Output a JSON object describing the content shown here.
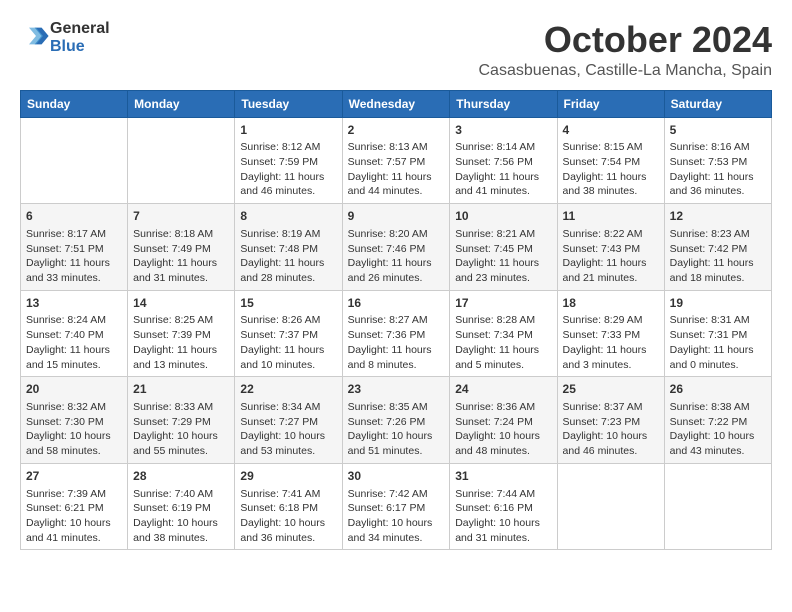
{
  "header": {
    "logo_line1": "General",
    "logo_line2": "Blue",
    "month": "October 2024",
    "location": "Casasbuenas, Castille-La Mancha, Spain"
  },
  "days_of_week": [
    "Sunday",
    "Monday",
    "Tuesday",
    "Wednesday",
    "Thursday",
    "Friday",
    "Saturday"
  ],
  "weeks": [
    [
      {
        "day": "",
        "content": ""
      },
      {
        "day": "",
        "content": ""
      },
      {
        "day": "1",
        "content": "Sunrise: 8:12 AM\nSunset: 7:59 PM\nDaylight: 11 hours and 46 minutes."
      },
      {
        "day": "2",
        "content": "Sunrise: 8:13 AM\nSunset: 7:57 PM\nDaylight: 11 hours and 44 minutes."
      },
      {
        "day": "3",
        "content": "Sunrise: 8:14 AM\nSunset: 7:56 PM\nDaylight: 11 hours and 41 minutes."
      },
      {
        "day": "4",
        "content": "Sunrise: 8:15 AM\nSunset: 7:54 PM\nDaylight: 11 hours and 38 minutes."
      },
      {
        "day": "5",
        "content": "Sunrise: 8:16 AM\nSunset: 7:53 PM\nDaylight: 11 hours and 36 minutes."
      }
    ],
    [
      {
        "day": "6",
        "content": "Sunrise: 8:17 AM\nSunset: 7:51 PM\nDaylight: 11 hours and 33 minutes."
      },
      {
        "day": "7",
        "content": "Sunrise: 8:18 AM\nSunset: 7:49 PM\nDaylight: 11 hours and 31 minutes."
      },
      {
        "day": "8",
        "content": "Sunrise: 8:19 AM\nSunset: 7:48 PM\nDaylight: 11 hours and 28 minutes."
      },
      {
        "day": "9",
        "content": "Sunrise: 8:20 AM\nSunset: 7:46 PM\nDaylight: 11 hours and 26 minutes."
      },
      {
        "day": "10",
        "content": "Sunrise: 8:21 AM\nSunset: 7:45 PM\nDaylight: 11 hours and 23 minutes."
      },
      {
        "day": "11",
        "content": "Sunrise: 8:22 AM\nSunset: 7:43 PM\nDaylight: 11 hours and 21 minutes."
      },
      {
        "day": "12",
        "content": "Sunrise: 8:23 AM\nSunset: 7:42 PM\nDaylight: 11 hours and 18 minutes."
      }
    ],
    [
      {
        "day": "13",
        "content": "Sunrise: 8:24 AM\nSunset: 7:40 PM\nDaylight: 11 hours and 15 minutes."
      },
      {
        "day": "14",
        "content": "Sunrise: 8:25 AM\nSunset: 7:39 PM\nDaylight: 11 hours and 13 minutes."
      },
      {
        "day": "15",
        "content": "Sunrise: 8:26 AM\nSunset: 7:37 PM\nDaylight: 11 hours and 10 minutes."
      },
      {
        "day": "16",
        "content": "Sunrise: 8:27 AM\nSunset: 7:36 PM\nDaylight: 11 hours and 8 minutes."
      },
      {
        "day": "17",
        "content": "Sunrise: 8:28 AM\nSunset: 7:34 PM\nDaylight: 11 hours and 5 minutes."
      },
      {
        "day": "18",
        "content": "Sunrise: 8:29 AM\nSunset: 7:33 PM\nDaylight: 11 hours and 3 minutes."
      },
      {
        "day": "19",
        "content": "Sunrise: 8:31 AM\nSunset: 7:31 PM\nDaylight: 11 hours and 0 minutes."
      }
    ],
    [
      {
        "day": "20",
        "content": "Sunrise: 8:32 AM\nSunset: 7:30 PM\nDaylight: 10 hours and 58 minutes."
      },
      {
        "day": "21",
        "content": "Sunrise: 8:33 AM\nSunset: 7:29 PM\nDaylight: 10 hours and 55 minutes."
      },
      {
        "day": "22",
        "content": "Sunrise: 8:34 AM\nSunset: 7:27 PM\nDaylight: 10 hours and 53 minutes."
      },
      {
        "day": "23",
        "content": "Sunrise: 8:35 AM\nSunset: 7:26 PM\nDaylight: 10 hours and 51 minutes."
      },
      {
        "day": "24",
        "content": "Sunrise: 8:36 AM\nSunset: 7:24 PM\nDaylight: 10 hours and 48 minutes."
      },
      {
        "day": "25",
        "content": "Sunrise: 8:37 AM\nSunset: 7:23 PM\nDaylight: 10 hours and 46 minutes."
      },
      {
        "day": "26",
        "content": "Sunrise: 8:38 AM\nSunset: 7:22 PM\nDaylight: 10 hours and 43 minutes."
      }
    ],
    [
      {
        "day": "27",
        "content": "Sunrise: 7:39 AM\nSunset: 6:21 PM\nDaylight: 10 hours and 41 minutes."
      },
      {
        "day": "28",
        "content": "Sunrise: 7:40 AM\nSunset: 6:19 PM\nDaylight: 10 hours and 38 minutes."
      },
      {
        "day": "29",
        "content": "Sunrise: 7:41 AM\nSunset: 6:18 PM\nDaylight: 10 hours and 36 minutes."
      },
      {
        "day": "30",
        "content": "Sunrise: 7:42 AM\nSunset: 6:17 PM\nDaylight: 10 hours and 34 minutes."
      },
      {
        "day": "31",
        "content": "Sunrise: 7:44 AM\nSunset: 6:16 PM\nDaylight: 10 hours and 31 minutes."
      },
      {
        "day": "",
        "content": ""
      },
      {
        "day": "",
        "content": ""
      }
    ]
  ]
}
